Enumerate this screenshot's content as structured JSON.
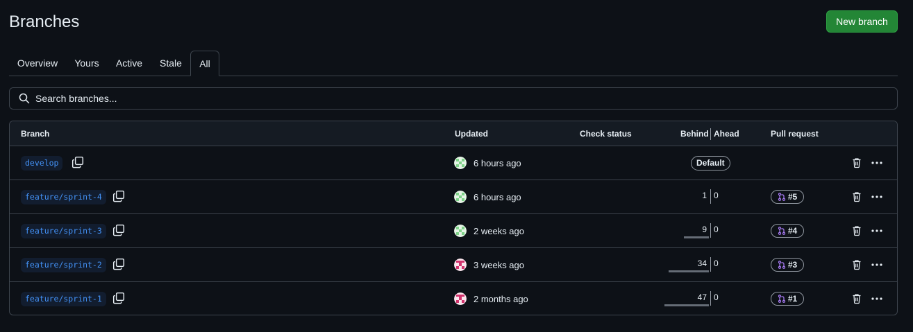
{
  "page": {
    "title": "Branches",
    "new_branch_label": "New branch"
  },
  "tabs": [
    {
      "label": "Overview",
      "active": false
    },
    {
      "label": "Yours",
      "active": false
    },
    {
      "label": "Active",
      "active": false
    },
    {
      "label": "Stale",
      "active": false
    },
    {
      "label": "All",
      "active": true
    }
  ],
  "search": {
    "placeholder": "Search branches..."
  },
  "table": {
    "headers": {
      "branch": "Branch",
      "updated": "Updated",
      "check_status": "Check status",
      "behind": "Behind",
      "ahead": "Ahead",
      "pull_request": "Pull request"
    },
    "rows": [
      {
        "name": "develop",
        "updated": "6 hours ago",
        "avatar": "green-identicon",
        "default_label": "Default",
        "behind": null,
        "ahead": null,
        "pr": null
      },
      {
        "name": "feature/sprint-4",
        "updated": "6 hours ago",
        "avatar": "green-identicon",
        "default_label": null,
        "behind": "1",
        "ahead": "0",
        "pr": "#5"
      },
      {
        "name": "feature/sprint-3",
        "updated": "2 weeks ago",
        "avatar": "green-identicon",
        "default_label": null,
        "behind": "9",
        "ahead": "0",
        "pr": "#4"
      },
      {
        "name": "feature/sprint-2",
        "updated": "3 weeks ago",
        "avatar": "pink-identicon",
        "default_label": null,
        "behind": "34",
        "ahead": "0",
        "pr": "#3"
      },
      {
        "name": "feature/sprint-1",
        "updated": "2 months ago",
        "avatar": "pink-identicon",
        "default_label": null,
        "behind": "47",
        "ahead": "0",
        "pr": "#1"
      }
    ]
  },
  "colors": {
    "background": "#0d1117",
    "accent_green": "#238636",
    "link_blue": "#4493f8",
    "pr_purple": "#ab7df8"
  }
}
